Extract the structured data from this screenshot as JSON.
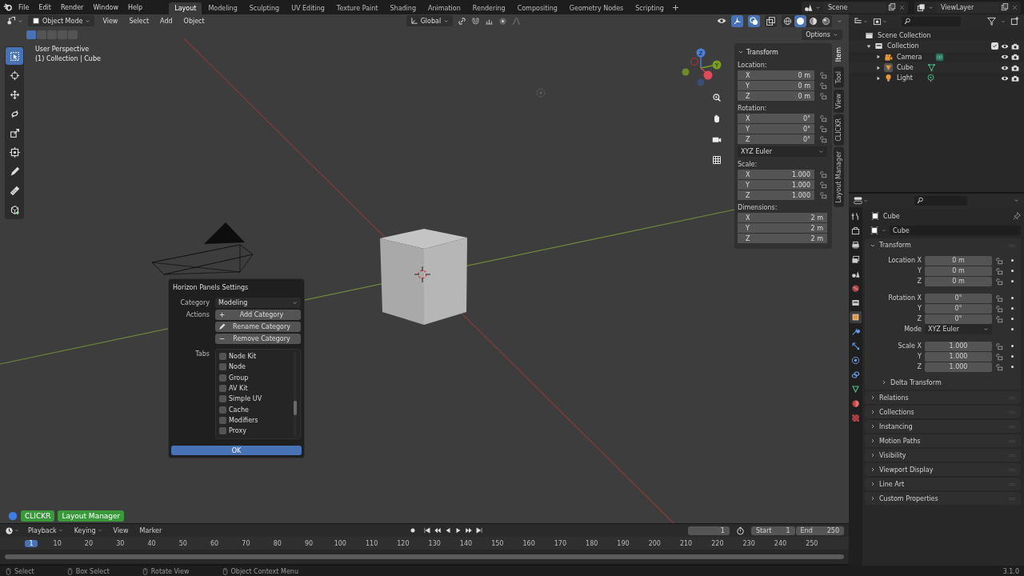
{
  "menu": [
    "File",
    "Edit",
    "Render",
    "Window",
    "Help"
  ],
  "workspaces": [
    {
      "label": "Layout",
      "selected": true
    },
    {
      "label": "Modeling",
      "selected": false
    },
    {
      "label": "Sculpting",
      "selected": false
    },
    {
      "label": "UV Editing",
      "selected": false
    },
    {
      "label": "Texture Paint",
      "selected": false
    },
    {
      "label": "Shading",
      "selected": false
    },
    {
      "label": "Animation",
      "selected": false
    },
    {
      "label": "Rendering",
      "selected": false
    },
    {
      "label": "Compositing",
      "selected": false
    },
    {
      "label": "Geometry Nodes",
      "selected": false
    },
    {
      "label": "Scripting",
      "selected": false
    }
  ],
  "scene": "Scene",
  "view_layer": "ViewLayer",
  "viewport": {
    "mode": "Object Mode",
    "menus": [
      "View",
      "Select",
      "Add",
      "Object"
    ],
    "orientation": "Global",
    "options": "Options",
    "select_modes": [
      {
        "selected": true
      },
      {
        "selected": false
      },
      {
        "selected": false
      },
      {
        "selected": false
      },
      {
        "selected": false
      }
    ],
    "header_toggles": [
      {
        "kind": "gizmos",
        "selected": true
      },
      {
        "kind": "overlays",
        "selected": true
      },
      {
        "kind": "xray",
        "selected": false
      }
    ],
    "shading": [
      {
        "kind": "wireframe",
        "selected": false
      },
      {
        "kind": "solid",
        "selected": true
      },
      {
        "kind": "material",
        "selected": false
      },
      {
        "kind": "rendered",
        "selected": false
      }
    ],
    "view_name": "User Perspective",
    "context": "(1) Collection | Cube",
    "tools": [
      {
        "kind": "select",
        "selected": true
      },
      {
        "kind": "cursor",
        "selected": false
      },
      {
        "kind": "move",
        "selected": false
      },
      {
        "kind": "rotate",
        "selected": false
      },
      {
        "kind": "scale",
        "selected": false
      },
      {
        "kind": "transform",
        "selected": false
      },
      {
        "kind": "annotate",
        "selected": false
      },
      {
        "kind": "measure",
        "selected": false
      },
      {
        "kind": "add_cube",
        "selected": false
      }
    ],
    "gizmo_labels": [
      "Z",
      "Y"
    ],
    "addon_buttons": [
      "CLICKR",
      "Layout Manager"
    ]
  },
  "sidebar": {
    "title": "Transform",
    "groups": [
      {
        "kind": "fields",
        "label": "Location:",
        "locks": true,
        "rows": [
          {
            "axis": "X",
            "value": "0 m"
          },
          {
            "axis": "Y",
            "value": "0 m"
          },
          {
            "axis": "Z",
            "value": "0 m"
          }
        ]
      },
      {
        "kind": "fields",
        "label": "Rotation:",
        "locks": true,
        "rows": [
          {
            "axis": "X",
            "value": "0°"
          },
          {
            "axis": "Y",
            "value": "0°"
          },
          {
            "axis": "Z",
            "value": "0°"
          }
        ]
      },
      {
        "kind": "dropdown",
        "value": "XYZ Euler"
      },
      {
        "kind": "fields",
        "label": "Scale:",
        "locks": true,
        "rows": [
          {
            "axis": "X",
            "value": "1.000"
          },
          {
            "axis": "Y",
            "value": "1.000"
          },
          {
            "axis": "Z",
            "value": "1.000"
          }
        ]
      },
      {
        "kind": "fields",
        "label": "Dimensions:",
        "locks": false,
        "rows": [
          {
            "axis": "X",
            "value": "2 m"
          },
          {
            "axis": "Y",
            "value": "2 m"
          },
          {
            "axis": "Z",
            "value": "2 m"
          }
        ]
      }
    ],
    "tabs": [
      {
        "label": "Item",
        "selected": true
      },
      {
        "label": "Tool",
        "selected": false
      },
      {
        "label": "View",
        "selected": false
      },
      {
        "label": "CLICKR",
        "selected": false
      },
      {
        "label": "Layout Manager",
        "selected": false
      }
    ]
  },
  "dialog": {
    "title": "Horizon Panels Settings",
    "category_label": "Category",
    "category": "Modeling",
    "actions_label": "Actions",
    "actions": [
      {
        "kind": "add",
        "label": "Add Category"
      },
      {
        "kind": "rename",
        "label": "Rename Category"
      },
      {
        "kind": "remove",
        "label": "Remove Category"
      }
    ],
    "tabs_label": "Tabs",
    "tabs": [
      {
        "label": "Node Kit",
        "checked": false
      },
      {
        "label": "Node",
        "checked": false
      },
      {
        "label": "Group",
        "checked": false
      },
      {
        "label": "AV Kit",
        "checked": false
      },
      {
        "label": "Simple UV",
        "checked": false
      },
      {
        "label": "Cache",
        "checked": false
      },
      {
        "label": "Modifiers",
        "checked": false
      },
      {
        "label": "Proxy",
        "checked": false
      }
    ],
    "ok": "OK"
  },
  "outliner": {
    "items": [
      {
        "label": "Scene Collection",
        "kind": "scene_collection",
        "children": [
          {
            "label": "Collection",
            "kind": "collection",
            "expanded": true,
            "checked": true,
            "children": [
              {
                "label": "Camera",
                "kind": "camera",
                "expanded": false,
                "active": false
              },
              {
                "label": "Cube",
                "kind": "mesh",
                "expanded": false,
                "active": true
              },
              {
                "label": "Light",
                "kind": "light",
                "expanded": false,
                "active": false
              }
            ]
          }
        ]
      }
    ]
  },
  "properties": {
    "tabs": [
      {
        "kind": "tool",
        "selected": false
      },
      {
        "kind": "render",
        "selected": false
      },
      {
        "kind": "output",
        "selected": false
      },
      {
        "kind": "view_layer",
        "selected": false
      },
      {
        "kind": "scene",
        "selected": false
      },
      {
        "kind": "world",
        "selected": false
      },
      {
        "kind": "collection",
        "selected": false
      },
      {
        "kind": "object",
        "selected": true
      },
      {
        "kind": "modifiers",
        "selected": false
      },
      {
        "kind": "particles",
        "selected": false
      },
      {
        "kind": "physics",
        "selected": false
      },
      {
        "kind": "constraints",
        "selected": false
      },
      {
        "kind": "data",
        "selected": false
      },
      {
        "kind": "material",
        "selected": false
      },
      {
        "kind": "texture",
        "selected": false
      }
    ],
    "object": "Cube",
    "name": "Cube",
    "transform": {
      "title": "Transform",
      "groups": [
        {
          "rows": [
            {
              "kind": "field",
              "label": "Location X",
              "value": "0 m"
            },
            {
              "kind": "field",
              "label": "Y",
              "value": "0 m"
            },
            {
              "kind": "field",
              "label": "Z",
              "value": "0 m"
            }
          ]
        },
        {
          "rows": [
            {
              "kind": "field",
              "label": "Rotation X",
              "value": "0°"
            },
            {
              "kind": "field",
              "label": "Y",
              "value": "0°"
            },
            {
              "kind": "field",
              "label": "Z",
              "value": "0°"
            },
            {
              "kind": "dropdown",
              "label": "Mode",
              "value": "XYZ Euler"
            }
          ]
        },
        {
          "rows": [
            {
              "kind": "field",
              "label": "Scale X",
              "value": "1.000"
            },
            {
              "kind": "field",
              "label": "Y",
              "value": "1.000"
            },
            {
              "kind": "field",
              "label": "Z",
              "value": "1.000"
            }
          ]
        }
      ],
      "delta": "Delta Transform"
    },
    "sections": [
      "Relations",
      "Collections",
      "Instancing",
      "Motion Paths",
      "Visibility",
      "Viewport Display",
      "Line Art",
      "Custom Properties"
    ]
  },
  "timeline": {
    "menus": [
      {
        "label": "Playback",
        "dropdown": true
      },
      {
        "label": "Keying",
        "dropdown": true
      },
      {
        "label": "View",
        "dropdown": false
      },
      {
        "label": "Marker",
        "dropdown": false
      }
    ],
    "frame": "1",
    "start_label": "Start",
    "start": "1",
    "end_label": "End",
    "end": "250",
    "ruler": [
      {
        "label": "1",
        "selected": true
      },
      {
        "label": "10",
        "selected": false
      },
      {
        "label": "20",
        "selected": false
      },
      {
        "label": "30",
        "selected": false
      },
      {
        "label": "40",
        "selected": false
      },
      {
        "label": "50",
        "selected": false
      },
      {
        "label": "60",
        "selected": false
      },
      {
        "label": "70",
        "selected": false
      },
      {
        "label": "80",
        "selected": false
      },
      {
        "label": "90",
        "selected": false
      },
      {
        "label": "100",
        "selected": false
      },
      {
        "label": "110",
        "selected": false
      },
      {
        "label": "120",
        "selected": false
      },
      {
        "label": "130",
        "selected": false
      },
      {
        "label": "140",
        "selected": false
      },
      {
        "label": "150",
        "selected": false
      },
      {
        "label": "160",
        "selected": false
      },
      {
        "label": "170",
        "selected": false
      },
      {
        "label": "180",
        "selected": false
      },
      {
        "label": "190",
        "selected": false
      },
      {
        "label": "200",
        "selected": false
      },
      {
        "label": "210",
        "selected": false
      },
      {
        "label": "220",
        "selected": false
      },
      {
        "label": "230",
        "selected": false
      },
      {
        "label": "240",
        "selected": false
      },
      {
        "label": "250",
        "selected": false
      }
    ]
  },
  "status_bar": {
    "hints": [
      "Select",
      "Box Select",
      "Rotate View",
      "Object Context Menu"
    ],
    "version": "3.1.0"
  }
}
